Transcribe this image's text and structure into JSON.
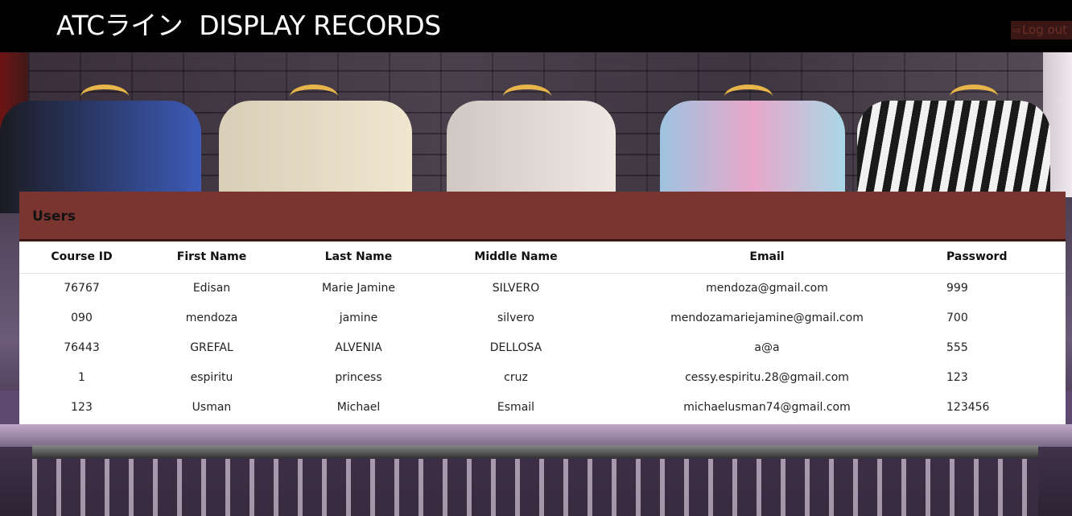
{
  "header": {
    "brand": "ATCライン",
    "page_title": "DISPLAY RECORDS",
    "logout_label": "Log out"
  },
  "card": {
    "title": "Users"
  },
  "table": {
    "columns": [
      "Course ID",
      "First Name",
      "Last Name",
      "Middle Name",
      "Email",
      "Password"
    ],
    "rows": [
      [
        "76767",
        "Edisan",
        "Marie Jamine",
        "SILVERO",
        "mendoza@gmail.com",
        "999"
      ],
      [
        "090",
        "mendoza",
        "jamine",
        "silvero",
        "mendozamariejamine@gmail.com",
        "700"
      ],
      [
        "76443",
        "GREFAL",
        "ALVENIA",
        "DELLOSA",
        "a@a",
        "555"
      ],
      [
        "1",
        "espiritu",
        "princess",
        "cruz",
        "cessy.espiritu.28@gmail.com",
        "123"
      ],
      [
        "123",
        "Usman",
        "Michael",
        "Esmail",
        "michaelusman74@gmail.com",
        "123456"
      ]
    ]
  },
  "colors": {
    "topbar": "#020202",
    "card_header": "#7a3530",
    "logout_bg": "#3a1714"
  }
}
